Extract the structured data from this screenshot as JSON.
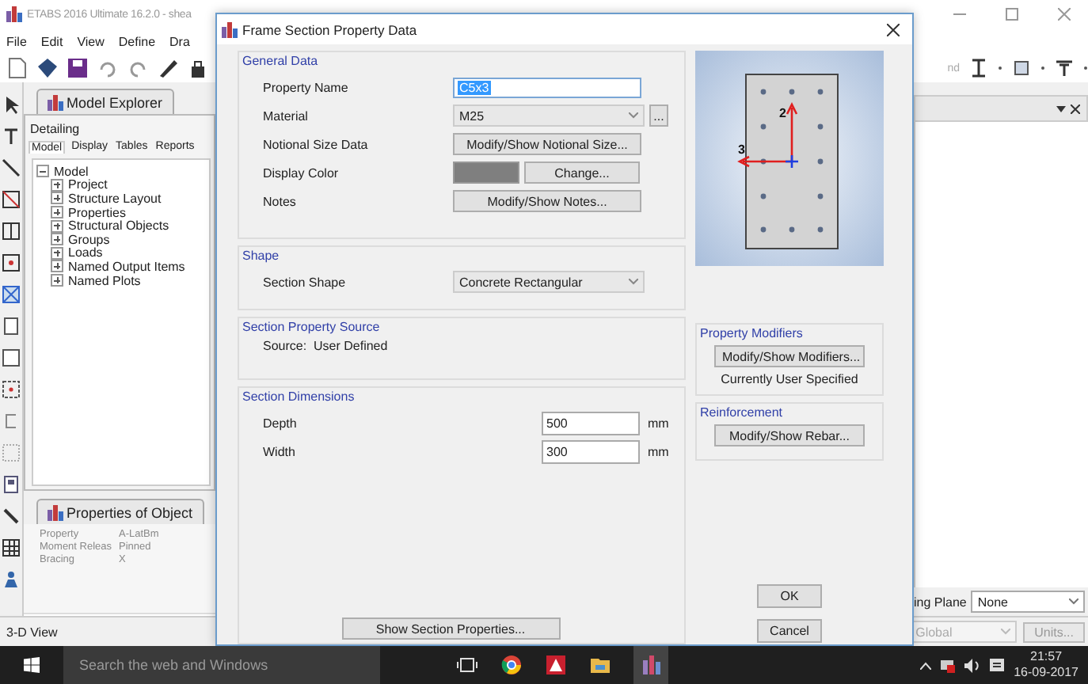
{
  "main_window": {
    "title": "ETABS 2016 Ultimate 16.2.0 - shea",
    "menu": [
      "File",
      "Edit",
      "View",
      "Define",
      "Dra"
    ],
    "toolbar_text": "nd",
    "model_explorer": {
      "tab": "Model Explorer",
      "section": "Detailing",
      "tabs": [
        {
          "label": "Model",
          "selected": true
        },
        {
          "label": "Display",
          "selected": false
        },
        {
          "label": "Tables",
          "selected": false
        },
        {
          "label": "Reports",
          "selected": false
        }
      ],
      "tree": [
        {
          "label": "Model",
          "expanded": true,
          "children": [
            {
              "label": "Project",
              "expanded": false
            },
            {
              "label": "Structure Layout",
              "expanded": false
            },
            {
              "label": "Properties",
              "expanded": false
            },
            {
              "label": "Structural Objects",
              "expanded": false
            },
            {
              "label": "Groups",
              "expanded": false
            },
            {
              "label": "Loads",
              "expanded": false
            },
            {
              "label": "Named Output Items",
              "expanded": false
            },
            {
              "label": "Named Plots",
              "expanded": false
            }
          ]
        }
      ]
    },
    "properties_of_object": {
      "tab": "Properties of Object",
      "rows": [
        [
          "Property",
          "A-LatBm"
        ],
        [
          "Moment Releas",
          "Pinned"
        ],
        [
          "Bracing",
          "X"
        ]
      ]
    },
    "plane": {
      "label": "ing Plane",
      "value": "None"
    },
    "status_bar": {
      "view": "3-D View",
      "coord_system": "Global",
      "units_button": "Units..."
    }
  },
  "dialog": {
    "title": "Frame Section Property Data",
    "general_data": {
      "title": "General Data",
      "rows": [
        {
          "label": "Property Name",
          "kind": "text",
          "value": "C5x3",
          "text_selected": true
        },
        {
          "label": "Material",
          "kind": "dropdown",
          "value": "M25",
          "more_button": "..."
        },
        {
          "label": "Notional Size Data",
          "kind": "button",
          "button": "Modify/Show Notional Size..."
        },
        {
          "label": "Display Color",
          "kind": "color",
          "color": "#7f7f7f",
          "button": "Change..."
        },
        {
          "label": "Notes",
          "kind": "button",
          "button": "Modify/Show Notes..."
        }
      ]
    },
    "shape": {
      "title": "Shape",
      "label": "Section Shape",
      "value": "Concrete Rectangular"
    },
    "source": {
      "title": "Section Property Source",
      "text": "Source:  User Defined"
    },
    "dimensions": {
      "title": "Section Dimensions",
      "rows": [
        {
          "label": "Depth",
          "value": "500",
          "unit": "mm"
        },
        {
          "label": "Width",
          "value": "300",
          "unit": "mm"
        }
      ],
      "button": "Show Section Properties..."
    },
    "preview": {
      "axis_labels": [
        "2",
        "3"
      ]
    },
    "modifiers": {
      "title": "Property Modifiers",
      "button": "Modify/Show Modifiers...",
      "status": "Currently User Specified"
    },
    "reinforcement": {
      "title": "Reinforcement",
      "button": "Modify/Show Rebar..."
    },
    "ok": "OK",
    "cancel": "Cancel"
  },
  "taskbar": {
    "search_placeholder": "Search the web and Windows",
    "time": "21:57",
    "date": "16-09-2017"
  }
}
